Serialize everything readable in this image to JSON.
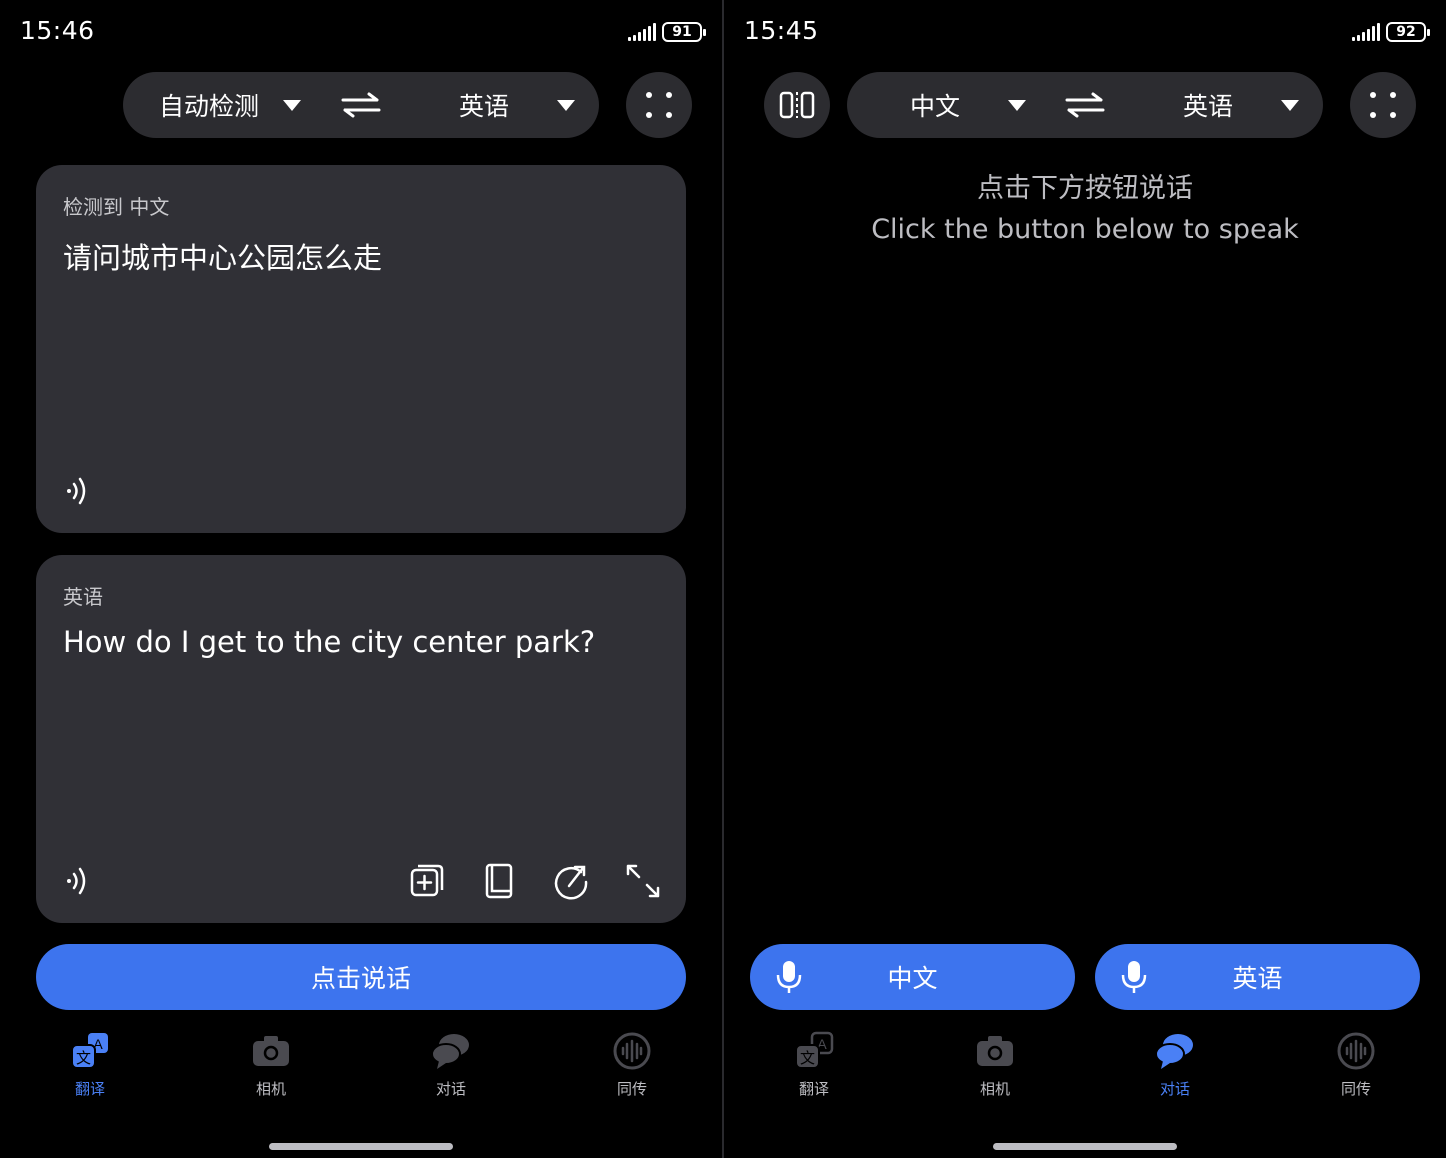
{
  "left": {
    "status": {
      "time": "15:46",
      "battery": "91"
    },
    "lang_bar": {
      "source": "自动检测",
      "target": "英语"
    },
    "source_card": {
      "label": "检测到 中文",
      "text": "请问城市中心公园怎么走"
    },
    "target_card": {
      "label": "英语",
      "text": "How do I get to the city center park?"
    },
    "speak_button": "点击说话",
    "nav": [
      "翻译",
      "相机",
      "对话",
      "同传"
    ],
    "active_tab": "翻译"
  },
  "right": {
    "status": {
      "time": "15:45",
      "battery": "92"
    },
    "lang_bar": {
      "source": "中文",
      "target": "英语"
    },
    "prompt_cn": "点击下方按钮说话",
    "prompt_en": "Click the button below to speak",
    "buttons": {
      "left": "中文",
      "right": "英语"
    },
    "nav": [
      "翻译",
      "相机",
      "对话",
      "同传"
    ],
    "active_tab": "对话"
  },
  "colors": {
    "accent": "#3d74ee",
    "card": "#303036",
    "pill": "#2c2c30",
    "background": "#000000"
  }
}
